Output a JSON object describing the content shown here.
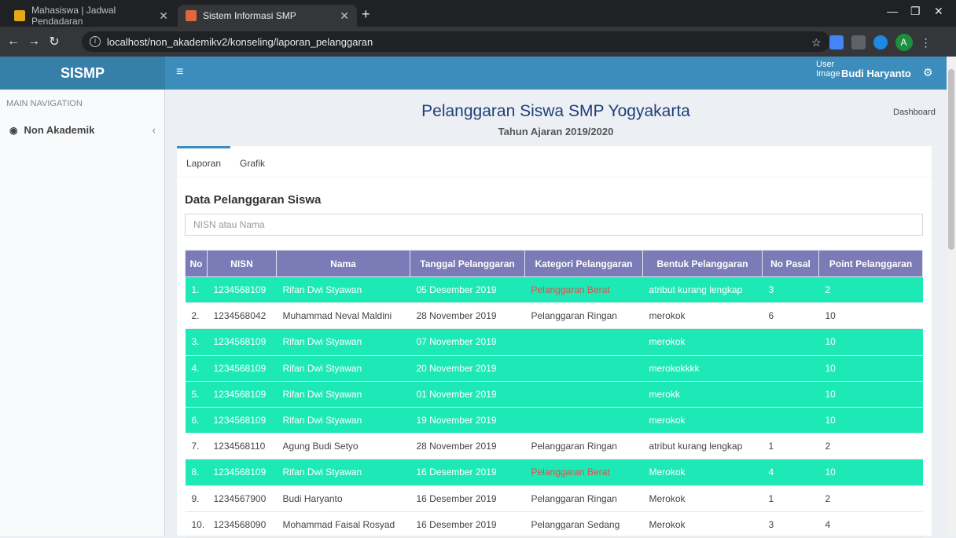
{
  "browser": {
    "tabs": [
      {
        "title": "Mahasiswa | Jadwal Pendadaran",
        "active": false
      },
      {
        "title": "Sistem Informasi SMP",
        "active": true
      }
    ],
    "url": "localhost/non_akademikv2/konseling/laporan_pelanggaran",
    "profile_letter": "A"
  },
  "header": {
    "logo": "SISMP",
    "user_image_alt": "User Image",
    "user_name": "Budi Haryanto"
  },
  "sidebar": {
    "heading": "MAIN NAVIGATION",
    "items": [
      {
        "label": "Non Akademik"
      }
    ]
  },
  "page": {
    "title": "Pelanggaran Siswa SMP Yogyakarta",
    "subtitle": "Tahun Ajaran 2019/2020",
    "breadcrumb": "Dashboard"
  },
  "tabs": [
    "Laporan",
    "Grafik"
  ],
  "section_title": "Data Pelanggaran Siswa",
  "search": {
    "placeholder": "NISN atau Nama"
  },
  "colors": {
    "highlight": "#1de9b6",
    "header": "#7b7bb8",
    "berat": "#d9534f"
  },
  "table": {
    "columns": [
      "No",
      "NISN",
      "Nama",
      "Tanggal Pelanggaran",
      "Kategori Pelanggaran",
      "Bentuk Pelanggaran",
      "No Pasal",
      "Point Pelanggaran"
    ],
    "rows": [
      {
        "no": "1.",
        "nisn": "1234568109",
        "nama": "Rifan Dwi Styawan",
        "tanggal": "05 Desember 2019",
        "kategori": "Pelanggaran Berat",
        "bentuk": "atribut kurang lengkap",
        "pasal": "3",
        "point": "2",
        "highlight": true
      },
      {
        "no": "2.",
        "nisn": "1234568042",
        "nama": "Muhammad Neval Maldini",
        "tanggal": "28 November 2019",
        "kategori": "Pelanggaran Ringan",
        "bentuk": "merokok",
        "pasal": "6",
        "point": "10",
        "highlight": false
      },
      {
        "no": "3.",
        "nisn": "1234568109",
        "nama": "Rifan Dwi Styawan",
        "tanggal": "07 November 2019",
        "kategori": "",
        "bentuk": "merokok",
        "pasal": "",
        "point": "10",
        "highlight": true
      },
      {
        "no": "4.",
        "nisn": "1234568109",
        "nama": "Rifan Dwi Styawan",
        "tanggal": "20 November 2019",
        "kategori": "",
        "bentuk": "merokokkkk",
        "pasal": "",
        "point": "10",
        "highlight": true
      },
      {
        "no": "5.",
        "nisn": "1234568109",
        "nama": "Rifan Dwi Styawan",
        "tanggal": "01 November 2019",
        "kategori": "",
        "bentuk": "merokk",
        "pasal": "",
        "point": "10",
        "highlight": true
      },
      {
        "no": "6.",
        "nisn": "1234568109",
        "nama": "Rifan Dwi Styawan",
        "tanggal": "19 November 2019",
        "kategori": "",
        "bentuk": "merokok",
        "pasal": "",
        "point": "10",
        "highlight": true
      },
      {
        "no": "7.",
        "nisn": "1234568110",
        "nama": "Agung Budi Setyo",
        "tanggal": "28 November 2019",
        "kategori": "Pelanggaran Ringan",
        "bentuk": "atribut kurang lengkap",
        "pasal": "1",
        "point": "2",
        "highlight": false
      },
      {
        "no": "8.",
        "nisn": "1234568109",
        "nama": "Rifan Dwi Styawan",
        "tanggal": "16 Desember 2019",
        "kategori": "Pelanggaran Berat",
        "bentuk": "Merokok",
        "pasal": "4",
        "point": "10",
        "highlight": true
      },
      {
        "no": "9.",
        "nisn": "1234567900",
        "nama": "Budi Haryanto",
        "tanggal": "16 Desember 2019",
        "kategori": "Pelanggaran Ringan",
        "bentuk": "Merokok",
        "pasal": "1",
        "point": "2",
        "highlight": false
      },
      {
        "no": "10.",
        "nisn": "1234568090",
        "nama": "Mohammad Faisal Rosyad",
        "tanggal": "16 Desember 2019",
        "kategori": "Pelanggaran Sedang",
        "bentuk": "Merokok",
        "pasal": "3",
        "point": "4",
        "highlight": false
      }
    ]
  }
}
